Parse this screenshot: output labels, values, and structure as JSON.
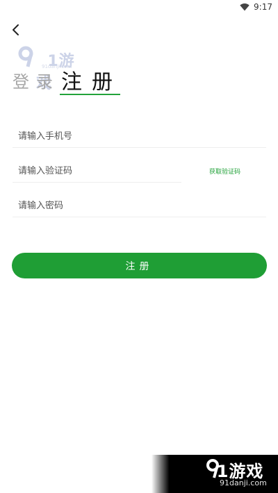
{
  "status_bar": {
    "time": "9:17",
    "wifi_icon": "wifi-icon"
  },
  "nav": {
    "back_icon": "chevron-left-icon"
  },
  "watermark": {
    "logo": "91游戏",
    "domain": "91danji.com"
  },
  "tabs": {
    "login": "登录",
    "register": "注册",
    "active": "register"
  },
  "form": {
    "phone_placeholder": "请输入手机号",
    "code_placeholder": "请输入验证码",
    "get_code_label": "获取验证码",
    "password_placeholder": "请输入密码"
  },
  "submit": {
    "label": "注册"
  },
  "brand": {
    "logo": "91游戏",
    "url": "91danji.com"
  },
  "colors": {
    "accent": "#1f9e35",
    "underline": "#23a23a",
    "inactive_tab": "#a7a7a7"
  }
}
